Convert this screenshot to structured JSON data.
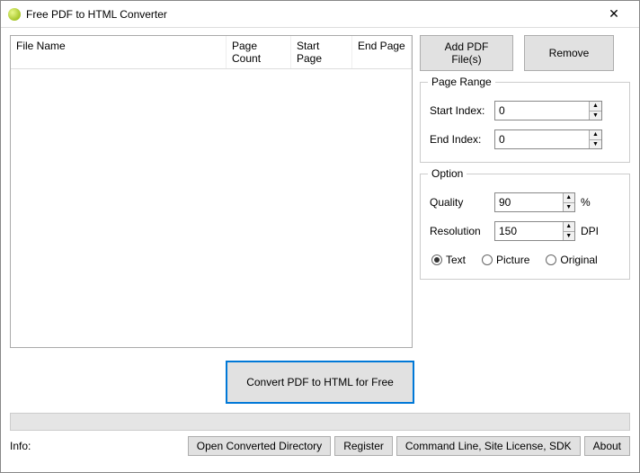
{
  "window": {
    "title": "Free PDF to HTML Converter"
  },
  "table": {
    "headers": {
      "file": "File Name",
      "pageCount": "Page Count",
      "startPage": "Start Page",
      "endPage": "End Page"
    }
  },
  "buttons": {
    "addPdf": "Add PDF File(s)",
    "remove": "Remove",
    "convert": "Convert PDF to HTML for Free"
  },
  "pageRange": {
    "legend": "Page Range",
    "startLabel": "Start Index:",
    "startValue": "0",
    "endLabel": "End Index:",
    "endValue": "0"
  },
  "option": {
    "legend": "Option",
    "qualityLabel": "Quality",
    "qualityValue": "90",
    "qualityUnit": "%",
    "resolutionLabel": "Resolution",
    "resolutionValue": "150",
    "resolutionUnit": "DPI",
    "radios": {
      "text": "Text",
      "picture": "Picture",
      "original": "Original",
      "selected": "text"
    }
  },
  "bottom": {
    "infoLabel": "Info:",
    "openDir": "Open Converted Directory",
    "register": "Register",
    "cmdline": "Command Line, Site License, SDK",
    "about": "About"
  }
}
